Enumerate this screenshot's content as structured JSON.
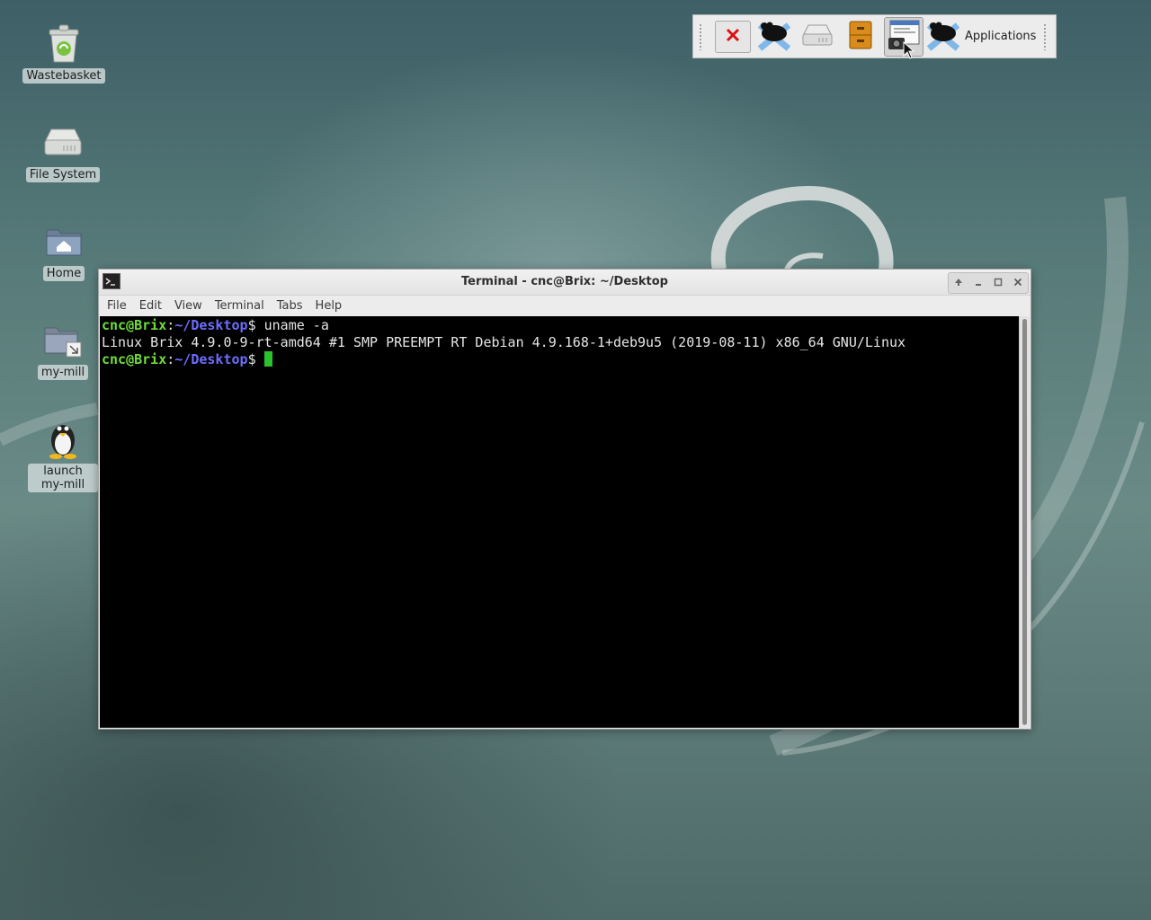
{
  "desktop": {
    "icons": [
      {
        "label": "Wastebasket",
        "icon": "trash-icon"
      },
      {
        "label": "File System",
        "icon": "drive-icon"
      },
      {
        "label": "Home",
        "icon": "home-folder-icon"
      },
      {
        "label": "my-mill",
        "icon": "folder-link-icon"
      },
      {
        "label": "launch my-mill",
        "icon": "penguin-icon"
      }
    ]
  },
  "panel": {
    "buttons": [
      {
        "name": "close-window",
        "icon": "close-icon"
      },
      {
        "name": "xfce-mouse",
        "icon": "xfce-mouse-icon"
      },
      {
        "name": "drive",
        "icon": "drive-icon"
      },
      {
        "name": "file-cabinet",
        "icon": "file-cabinet-icon"
      },
      {
        "name": "screenshot",
        "icon": "screenshot-icon",
        "active": true
      }
    ],
    "applications_label": "Applications"
  },
  "terminal": {
    "title": "Terminal - cnc@Brix: ~/Desktop",
    "menu": [
      "File",
      "Edit",
      "View",
      "Terminal",
      "Tabs",
      "Help"
    ],
    "prompt_user": "cnc@Brix",
    "prompt_sep": ":",
    "prompt_path": "~/Desktop",
    "prompt_end": "$ ",
    "command": "uname -a",
    "output": "Linux Brix 4.9.0-9-rt-amd64 #1 SMP PREEMPT RT Debian 4.9.168-1+deb9u5 (2019-08-11) x86_64 GNU/Linux"
  },
  "colors": {
    "prompt_user": "#6fdc3c",
    "prompt_path": "#6d6dff",
    "cursor": "#2bc22b",
    "terminal_bg": "#000000"
  }
}
